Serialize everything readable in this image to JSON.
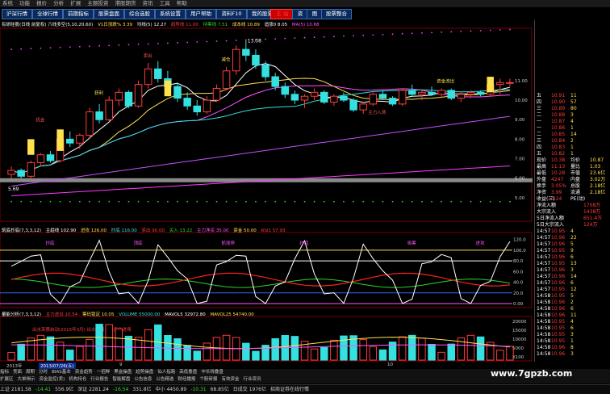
{
  "menu": [
    "系统",
    "功能",
    "报价",
    "分析",
    "扩展",
    "主题投资",
    "港股期货",
    "资讯",
    "工具",
    "帮助"
  ],
  "toolbar": {
    "buttons": [
      "沪深行情",
      "全球行情",
      "前期指标",
      "股票盘面",
      "综合选股",
      "系统设置",
      "用户帮助",
      "资料F10",
      "我的股票"
    ],
    "center_label": "王 站",
    "right_buttons": [
      "资",
      "图",
      "股票整合"
    ]
  },
  "main": {
    "title": "有研硅股(日线 前复权) 六线多空(5,10,20,60)",
    "legend": [
      "V1日涨跌% 3.39",
      "均线(5) 12.27",
      "趋势线 11.00",
      "持筹线 7.51",
      "成本线 10.89",
      "追涨0 8.05",
      "MA(5) 10.68",
      "10.32"
    ],
    "price_labels": [
      "13.08",
      "5.69"
    ],
    "annotations": [
      "机会",
      "获利",
      "卖出",
      "减仓",
      "主力入场",
      "资金流出"
    ],
    "y_ticks": [
      "11.00",
      "10.00",
      "9.00",
      "8.00",
      "7.00",
      "6.00",
      "5.00"
    ]
  },
  "sub1": {
    "legend": [
      "筑底抄底(7,3,3,12)",
      "主趋线 102.90",
      "进攻 126.00",
      "抄底 116.00",
      "卖出 90.00",
      "买入 13.22",
      "主力净买 35.00",
      "资金 50.00",
      "能量 19.00",
      "RSI1 57.93",
      "W4 38.00",
      "黄线 10.00"
    ],
    "y_ticks": [
      "120.0",
      "100.0",
      "80.0",
      "60.0",
      "40.0",
      "20.0",
      "0.00"
    ],
    "labels": [
      "抄底",
      "顶底",
      "抓涨停",
      "抄底",
      "吸筹",
      "进攻"
    ]
  },
  "sub2": {
    "legend": [
      "量能分析(7,3,3,12)",
      "主力进出 10.54",
      "筹码锁定 10.05",
      "VOLUME 55000.00",
      "MAVOL5 32972.80",
      "MAVOL25 54740.00",
      "MAVOL144 42099.55"
    ],
    "note": "出水芙蓉启动(2015年3月) 出水芙蓉主力资金进场",
    "y_ticks": [
      "20000",
      "15000",
      "10000",
      "5000",
      "X100"
    ]
  },
  "rpanel": {
    "asks": [
      {
        "label": "五",
        "price": "10.91",
        "vol": "11"
      },
      {
        "label": "四",
        "price": "10.90",
        "vol": "57"
      },
      {
        "label": "三",
        "price": "10.89",
        "vol": "80"
      },
      {
        "label": "二",
        "price": "10.88",
        "vol": "3"
      },
      {
        "label": "一",
        "price": "10.87",
        "vol": "4"
      }
    ],
    "bids": [
      {
        "label": "一",
        "price": "10.86",
        "vol": "1"
      },
      {
        "label": "二",
        "price": "10.85",
        "vol": "14"
      },
      {
        "label": "三",
        "price": "10.84",
        "vol": "2"
      },
      {
        "label": "四",
        "price": "10.83",
        "vol": "1"
      },
      {
        "label": "五",
        "price": "10.82",
        "vol": "1"
      }
    ],
    "stats": [
      [
        "现价",
        "10.38",
        "均价",
        "10.87"
      ],
      [
        "最高",
        "11.13",
        "量比",
        "1.03"
      ],
      [
        "最低",
        "10.28",
        "市值",
        "23.6亿"
      ],
      [
        "外盘",
        "4247",
        "内盘",
        "3.02万"
      ],
      [
        "换手",
        "3.05%",
        "总股",
        "2.18亿"
      ],
      [
        "净资",
        "3.99",
        "流通",
        "2.18亿"
      ],
      [
        "收益(三)",
        "0.24",
        "PE(动)",
        ""
      ]
    ],
    "flows": [
      [
        "净流入额",
        "1708万"
      ],
      [
        "大宗流入",
        "1438万"
      ],
      [
        "5日净流入额",
        "651.4万"
      ],
      [
        "5日大宗流入",
        "124万"
      ]
    ],
    "ticks": [
      [
        "14:57",
        "10.95",
        "4"
      ],
      [
        "14:57",
        "10.96",
        "22"
      ],
      [
        "14:57",
        "10.96",
        "5"
      ],
      [
        "14:57",
        "10.95",
        "9"
      ],
      [
        "14:57",
        "10.96",
        "6"
      ],
      [
        "14:57",
        "10.95",
        "13"
      ],
      [
        "14:57",
        "10.96",
        "3"
      ],
      [
        "14:57",
        "10.96",
        "14"
      ],
      [
        "14:57",
        "10.96",
        "6"
      ],
      [
        "14:57",
        "10.95",
        "12"
      ],
      [
        "14:58",
        "10.95",
        "5"
      ],
      [
        "14:58",
        "10.96",
        "2"
      ],
      [
        "14:58",
        "10.96",
        "6"
      ],
      [
        "14:58",
        "10.96",
        "11"
      ],
      [
        "14:58",
        "10.95",
        "4"
      ],
      [
        "14:58",
        "10.95",
        "6"
      ],
      [
        "14:58",
        "10.95",
        "3"
      ],
      [
        "14:58",
        "10.95",
        "1"
      ],
      [
        "14:58",
        "10.96",
        "8"
      ],
      [
        "14:58",
        "10.96",
        "3"
      ],
      [
        "14:58",
        "10.96",
        "2"
      ],
      [
        "14:58",
        "10.95",
        "2"
      ],
      [
        "14:59",
        "10.95",
        "1"
      ],
      [
        "14:59",
        "10.95",
        "6"
      ],
      [
        "14:59",
        "10.95",
        "9"
      ],
      [
        "14:59",
        "10.96",
        "5"
      ]
    ]
  },
  "axis": {
    "year": "2013年",
    "date": "2013/07/26(五)",
    "tick1": "9",
    "tick2": "10"
  },
  "tabs1": [
    "指标",
    "竞面",
    "周期",
    "分时",
    "BIAS基本",
    "资金趋势",
    "一招鲜",
    "黑盒操盘",
    "趋势操盘",
    "仙人指路",
    "高低叠盘",
    "中长线叠盘"
  ],
  "tabs2": [
    "扩展区",
    "大单揭示",
    "资金监控(卖)",
    "机构持仓",
    "行业报告",
    "智能解盘",
    "公告信息",
    "公告精选",
    "财经播报",
    "个股研报",
    "有效资金",
    "行业资讯"
  ],
  "status": [
    "上证 2181.58",
    "-14.41",
    "556.9亿",
    "深证 2281.24",
    "-16.54",
    "331.8亿",
    "中小 4450.89",
    "-10.31",
    "68.85亿",
    "日成交 1976亿",
    "招商证券在线行情"
  ],
  "watermark": "www.7gpzb.com",
  "colors": {
    "up": "#ff3b3b",
    "down": "#2bd62b",
    "accent": "#ffe14d",
    "cyan": "#35e0e0",
    "magenta": "#ff55ff"
  },
  "candles": [
    [
      6.2,
      6.6,
      6.0,
      6.4
    ],
    [
      6.4,
      6.5,
      6.0,
      6.1
    ],
    [
      6.1,
      6.9,
      6.0,
      6.8
    ],
    [
      6.8,
      7.3,
      6.6,
      7.2
    ],
    [
      7.2,
      7.4,
      6.8,
      6.9
    ],
    [
      6.9,
      8.2,
      6.8,
      8.0
    ],
    [
      8.0,
      8.4,
      7.6,
      7.8
    ],
    [
      7.8,
      8.3,
      7.5,
      8.2
    ],
    [
      8.2,
      9.6,
      8.0,
      9.4
    ],
    [
      9.4,
      9.8,
      8.8,
      9.0
    ],
    [
      9.0,
      10.2,
      8.9,
      10.0
    ],
    [
      10.0,
      10.6,
      9.7,
      10.4
    ],
    [
      10.4,
      10.5,
      9.6,
      9.7
    ],
    [
      9.7,
      11.0,
      9.6,
      10.8
    ],
    [
      10.8,
      11.9,
      10.6,
      11.6
    ],
    [
      11.6,
      12.0,
      10.9,
      11.1
    ],
    [
      11.1,
      11.5,
      10.5,
      10.7
    ],
    [
      10.7,
      10.9,
      9.9,
      10.1
    ],
    [
      10.1,
      10.4,
      9.5,
      9.7
    ],
    [
      9.7,
      10.0,
      9.2,
      9.4
    ],
    [
      9.4,
      10.2,
      9.3,
      10.0
    ],
    [
      10.0,
      10.8,
      9.9,
      10.6
    ],
    [
      10.6,
      11.7,
      10.5,
      11.5
    ],
    [
      11.5,
      12.8,
      11.3,
      12.6
    ],
    [
      12.6,
      13.1,
      12.0,
      12.3
    ],
    [
      12.3,
      12.6,
      11.6,
      11.8
    ],
    [
      11.8,
      12.0,
      11.0,
      11.2
    ],
    [
      11.2,
      11.4,
      10.5,
      10.7
    ],
    [
      10.7,
      10.9,
      10.1,
      10.3
    ],
    [
      10.3,
      10.5,
      9.8,
      10.0
    ],
    [
      10.0,
      10.3,
      9.6,
      10.2
    ],
    [
      10.2,
      10.6,
      10.0,
      10.4
    ],
    [
      10.4,
      10.5,
      9.8,
      9.9
    ],
    [
      9.9,
      10.3,
      9.7,
      10.2
    ],
    [
      10.2,
      10.4,
      9.9,
      10.0
    ],
    [
      10.0,
      10.1,
      9.4,
      9.5
    ],
    [
      9.5,
      9.9,
      9.3,
      9.8
    ],
    [
      9.8,
      10.4,
      9.7,
      10.3
    ],
    [
      10.3,
      10.5,
      10.0,
      10.1
    ],
    [
      10.1,
      10.2,
      9.7,
      9.8
    ],
    [
      9.8,
      10.6,
      9.7,
      10.5
    ],
    [
      10.5,
      10.8,
      10.2,
      10.3
    ],
    [
      10.3,
      10.5,
      10.0,
      10.4
    ],
    [
      10.4,
      10.7,
      10.2,
      10.3
    ],
    [
      10.3,
      10.6,
      10.1,
      10.5
    ],
    [
      10.5,
      10.6,
      10.0,
      10.1
    ],
    [
      10.1,
      10.4,
      9.9,
      10.3
    ],
    [
      10.3,
      10.5,
      10.1,
      10.4
    ],
    [
      10.4,
      10.5,
      10.2,
      10.3
    ],
    [
      10.3,
      10.9,
      10.2,
      10.8
    ],
    [
      10.8,
      11.1,
      10.3,
      10.9
    ],
    [
      10.9,
      11.1,
      10.7,
      10.9
    ]
  ]
}
